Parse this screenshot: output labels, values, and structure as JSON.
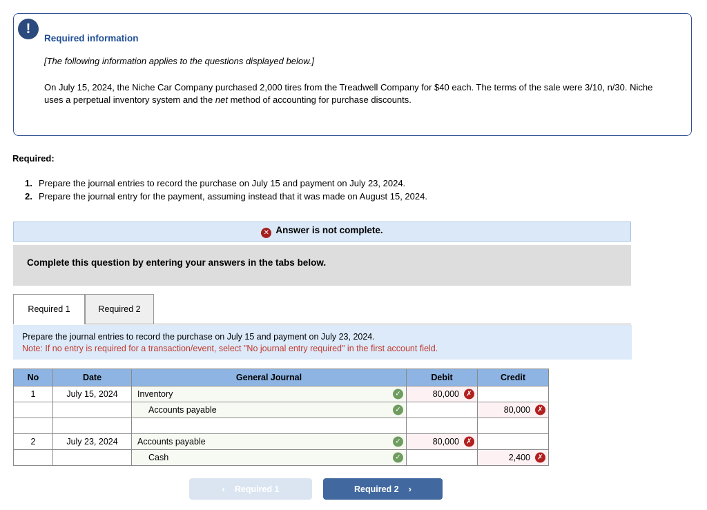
{
  "info_box": {
    "badge_icon": "exclamation-icon",
    "badge_glyph": "!",
    "title": "Required information",
    "italic_note": "[The following information applies to the questions displayed below.]",
    "body_part1": "On July 15, 2024, the Niche Car Company purchased 2,000 tires from the Treadwell Company for $40 each. The terms of the sale were 3/10, n/30. Niche uses a perpetual inventory system and the ",
    "body_emphasis": "net",
    "body_part2": " method of accounting for purchase discounts."
  },
  "required": {
    "heading": "Required:",
    "items": [
      {
        "num": "1.",
        "text": "Prepare the journal entries to record the purchase on July 15 and payment on July 23, 2024."
      },
      {
        "num": "2.",
        "text": "Prepare the journal entry for the payment, assuming instead that it was made on August 15, 2024."
      }
    ]
  },
  "answer_bar": {
    "icon": "error-x-icon",
    "icon_glyph": "✕",
    "text": "Answer is not complete."
  },
  "complete_bar": {
    "text": "Complete this question by entering your answers in the tabs below."
  },
  "tabs": [
    {
      "label": "Required 1",
      "active": true
    },
    {
      "label": "Required 2",
      "active": false
    }
  ],
  "note_panel": {
    "line1": "Prepare the journal entries to record the purchase on July 15 and payment on July 23, 2024.",
    "line2": "Note: If no entry is required for a transaction/event, select \"No journal entry required\" in the first account field."
  },
  "journal": {
    "columns": [
      "No",
      "Date",
      "General Journal",
      "Debit",
      "Credit"
    ],
    "rows": [
      {
        "no": "1",
        "date": "July 15, 2024",
        "account": "Inventory",
        "indent": false,
        "account_mark": "ok",
        "debit": "80,000",
        "debit_mark": "bad",
        "credit": "",
        "credit_mark": ""
      },
      {
        "no": "",
        "date": "",
        "account": "Accounts payable",
        "indent": true,
        "account_mark": "ok",
        "debit": "",
        "debit_mark": "",
        "credit": "80,000",
        "credit_mark": "bad"
      },
      {
        "no": "",
        "date": "",
        "account": "",
        "indent": false,
        "account_mark": "",
        "debit": "",
        "debit_mark": "",
        "credit": "",
        "credit_mark": ""
      },
      {
        "no": "2",
        "date": "July 23, 2024",
        "account": "Accounts payable",
        "indent": false,
        "account_mark": "ok",
        "debit": "80,000",
        "debit_mark": "bad",
        "credit": "",
        "credit_mark": ""
      },
      {
        "no": "",
        "date": "",
        "account": "Cash",
        "indent": true,
        "account_mark": "ok",
        "debit": "",
        "debit_mark": "",
        "credit": "2,400",
        "credit_mark": "bad"
      }
    ]
  },
  "nav": {
    "prev_label": "Required 1",
    "prev_icon": "chevron-left-icon",
    "prev_glyph": "‹",
    "next_label": "Required 2",
    "next_icon": "chevron-right-icon",
    "next_glyph": "›"
  },
  "colors": {
    "info_border": "#2f4f8f",
    "badge": "#2b4b7e",
    "title_blue": "#1f4e96",
    "answer_bar_bg": "#dbe8f7",
    "error_red": "#a51f1f",
    "gray_bar": "#dddddd",
    "note_bg": "#dceafa",
    "note_red": "#c0392b",
    "table_header": "#8db4e2",
    "check_green": "#6f9c5f",
    "x_red": "#b02020",
    "next_btn": "#41689f",
    "prev_btn": "#dbe5f1"
  }
}
